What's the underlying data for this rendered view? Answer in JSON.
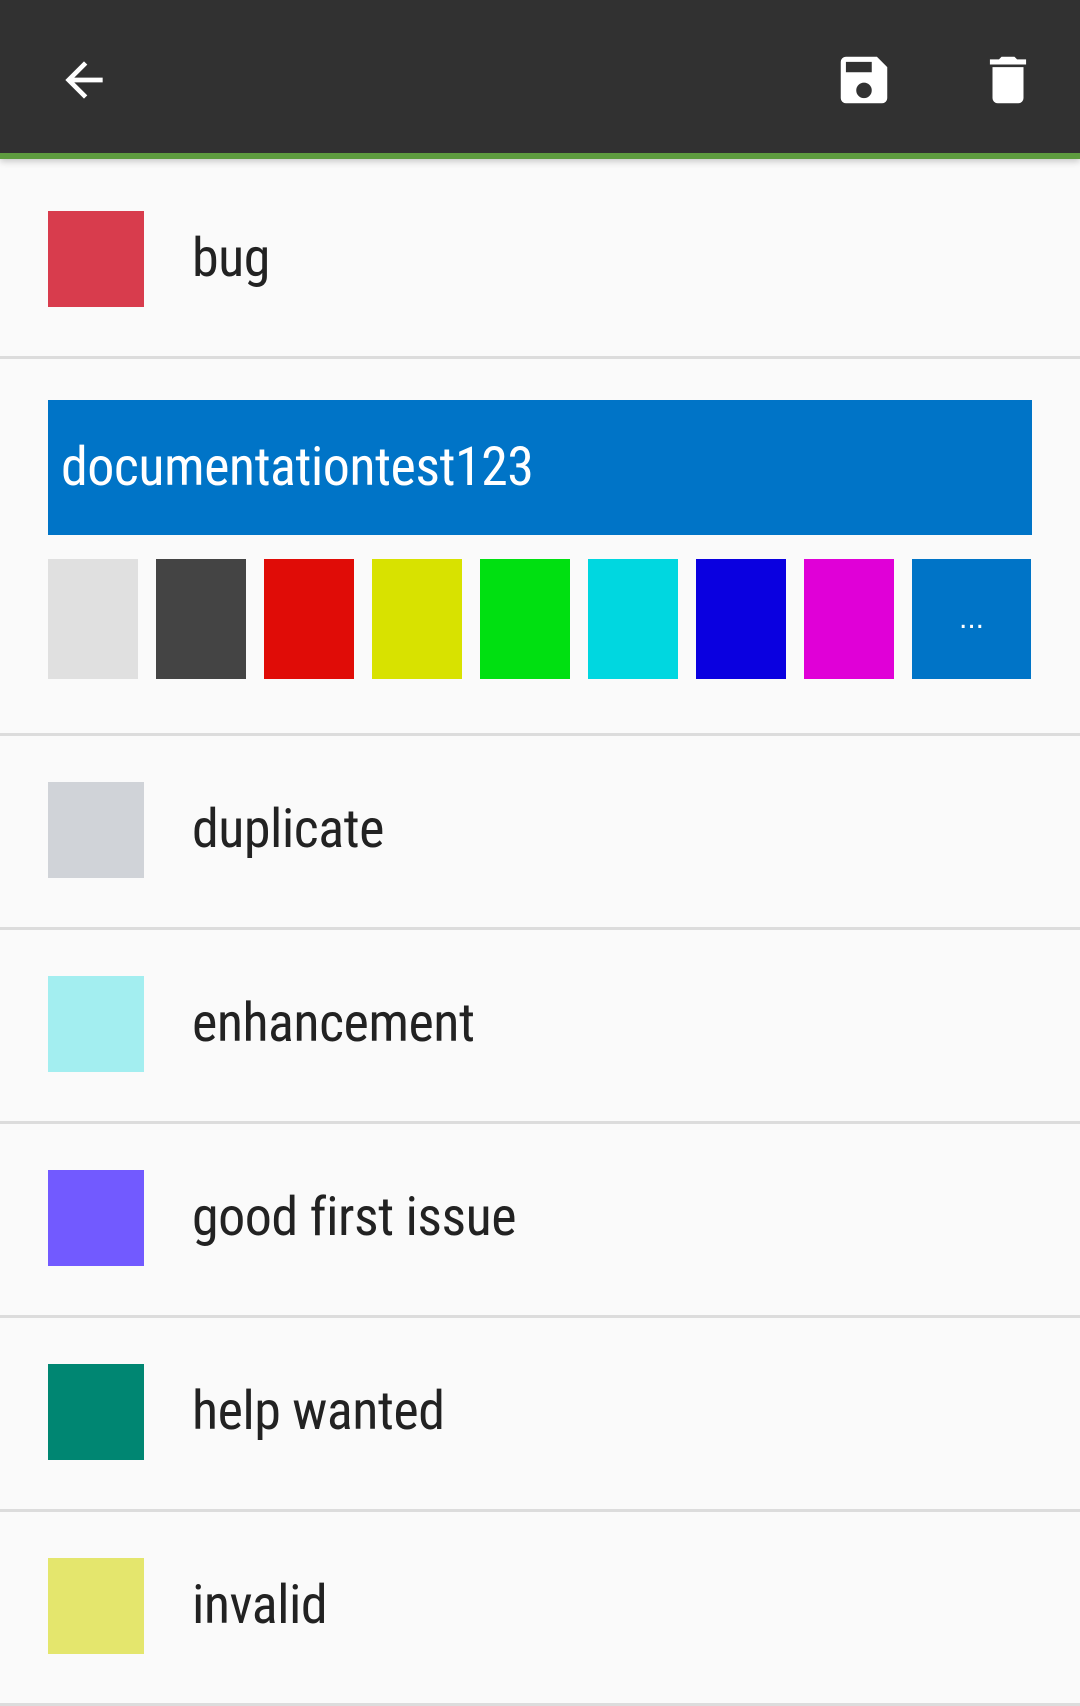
{
  "toolbar": {
    "back_icon": "arrow-left-icon",
    "save_icon": "floppy-disk-icon",
    "delete_icon": "trash-icon"
  },
  "labels": [
    {
      "name": "bug",
      "color": "#d83c4d"
    },
    {
      "name": "duplicate",
      "color": "#d0d3d8"
    },
    {
      "name": "enhancement",
      "color": "#a3eef0"
    },
    {
      "name": "good first issue",
      "color": "#725aff"
    },
    {
      "name": "help wanted",
      "color": "#008672"
    },
    {
      "name": "invalid",
      "color": "#e4e66d"
    }
  ],
  "editor": {
    "value": "documentationtest123",
    "color": "#0074c7",
    "palette": [
      "#e0e0e0",
      "#444444",
      "#e00c07",
      "#d8e200",
      "#00e011",
      "#00d7e0",
      "#0a00e0",
      "#e000d7"
    ],
    "more_label": "..."
  }
}
